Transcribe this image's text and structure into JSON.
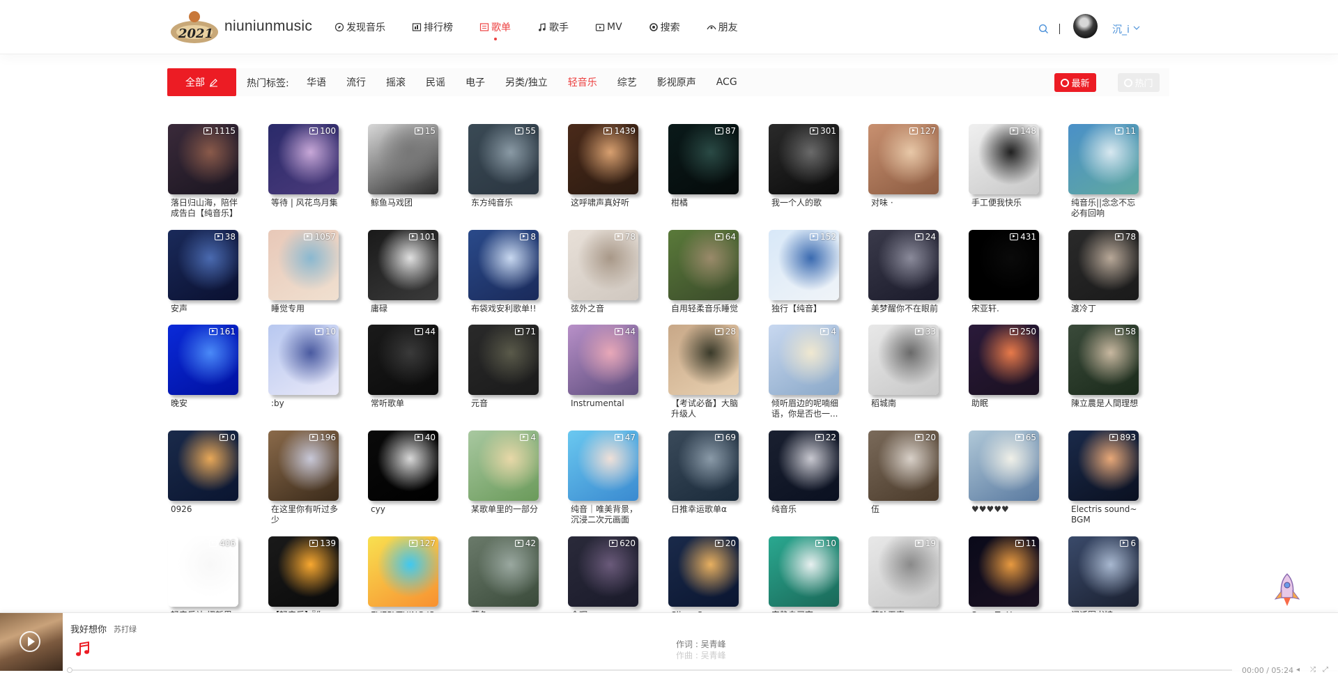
{
  "header": {
    "brand": "niuniunmusic",
    "logo_text": "2021",
    "nav": [
      {
        "label": "发现音乐",
        "icon": "discover-icon",
        "active": false
      },
      {
        "label": "排行榜",
        "icon": "ranking-icon",
        "active": false
      },
      {
        "label": "歌单",
        "icon": "playlist-icon",
        "active": true
      },
      {
        "label": "歌手",
        "icon": "singer-icon",
        "active": false
      },
      {
        "label": "MV",
        "icon": "mv-icon",
        "active": false
      },
      {
        "label": "搜索",
        "icon": "search-nav-icon",
        "active": false
      },
      {
        "label": "朋友",
        "icon": "friends-icon",
        "active": false
      }
    ],
    "user_name": "沉_i"
  },
  "filter": {
    "all_label": "全部",
    "hot_tags_label": "热门标签:",
    "tags": [
      "华语",
      "流行",
      "摇滚",
      "民谣",
      "电子",
      "另类/独立",
      "轻音乐",
      "综艺",
      "影视原声",
      "ACG"
    ],
    "active_tag": "轻音乐",
    "newest_label": "最新",
    "hottest_label": "热门"
  },
  "playlists": [
    {
      "title": "落日归山海，陪伴成告白【纯音乐】",
      "count": "1115",
      "colors": [
        "#3a2a3a",
        "#8a5a4a",
        "#1a1520"
      ]
    },
    {
      "title": "等待 | 风花鸟月集",
      "count": "100",
      "colors": [
        "#2a2a6a",
        "#c8a8d8",
        "#4a3a7a"
      ]
    },
    {
      "title": "鲸鱼马戏团",
      "count": "15",
      "colors": [
        "#d8d8d8",
        "#777777",
        "#2a2a2a"
      ]
    },
    {
      "title": "东方纯音乐",
      "count": "55",
      "colors": [
        "#3a4a55",
        "#8a9aa5",
        "#2a3540"
      ]
    },
    {
      "title": "这呼啸声真好听",
      "count": "1439",
      "colors": [
        "#4a2a1a",
        "#d8a070",
        "#2a1a10"
      ]
    },
    {
      "title": "柑橘",
      "count": "87",
      "colors": [
        "#0a1a1a",
        "#2a4a45",
        "#050a0a"
      ]
    },
    {
      "title": "我一个人的歌",
      "count": "301",
      "colors": [
        "#2a2a2a",
        "#6a6a6a",
        "#0a0a0a"
      ]
    },
    {
      "title": "对味 ·",
      "count": "127",
      "colors": [
        "#c89070",
        "#e8c8a8",
        "#8a5a40"
      ]
    },
    {
      "title": "手工便我快乐",
      "count": "148",
      "colors": [
        "#f0f0f0",
        "#202020",
        "#c8c8c8"
      ]
    },
    {
      "title": "纯音乐||念念不忘必有回响",
      "count": "11",
      "colors": [
        "#4a90c8",
        "#d8e8f0",
        "#60a8a0"
      ]
    },
    {
      "title": "安声",
      "count": "38",
      "colors": [
        "#1a2a5a",
        "#4a6ab0",
        "#0a1030"
      ]
    },
    {
      "title": "睡觉专用",
      "count": "1057",
      "colors": [
        "#e8c8b8",
        "#8ab8d0",
        "#f0e0d0"
      ]
    },
    {
      "title": "庸碌",
      "count": "101",
      "colors": [
        "#1a1a1a",
        "#e0e0e0",
        "#3a3a3a"
      ]
    },
    {
      "title": "布袋戏安利歌单!!",
      "count": "8",
      "colors": [
        "#2a4a8a",
        "#c8d8f0",
        "#1a2a5a"
      ]
    },
    {
      "title": "弦外之音",
      "count": "78",
      "colors": [
        "#e8e0d8",
        "#a89888",
        "#d0c8c0"
      ]
    },
    {
      "title": "自用轻柔音乐睡觉",
      "count": "64",
      "colors": [
        "#5a7a3a",
        "#9a8a6a",
        "#3a4a2a"
      ]
    },
    {
      "title": "独行【纯音】",
      "count": "152",
      "colors": [
        "#d8e8f8",
        "#3a6ab0",
        "#f0f4f8"
      ]
    },
    {
      "title": "美梦醒你不在眼前",
      "count": "24",
      "colors": [
        "#3a3a4a",
        "#8a8a9a",
        "#1a1a2a"
      ]
    },
    {
      "title": "宋亚轩.",
      "count": "431",
      "colors": [
        "#000000",
        "#0a0a0a",
        "#000000"
      ]
    },
    {
      "title": "渡冷丁",
      "count": "78",
      "colors": [
        "#2a2a2a",
        "#b8a898",
        "#1a1a1a"
      ]
    },
    {
      "title": "晚安",
      "count": "161",
      "colors": [
        "#0a2ad8",
        "#4a8af8",
        "#0010a0"
      ]
    },
    {
      "title": ":by",
      "count": "10",
      "colors": [
        "#b8c8f0",
        "#4a5aa0",
        "#e8e8f8"
      ]
    },
    {
      "title": "常听歌单",
      "count": "44",
      "colors": [
        "#1a1a1a",
        "#3a3a3a",
        "#0a0a0a"
      ]
    },
    {
      "title": "元音",
      "count": "71",
      "colors": [
        "#2a2a2a",
        "#5a5a4a",
        "#1a1a1a"
      ]
    },
    {
      "title": "Instrumental",
      "count": "44",
      "colors": [
        "#b890c8",
        "#e8a8b8",
        "#5a4a7a"
      ]
    },
    {
      "title": "【考试必备】大脑升级人",
      "count": "28",
      "colors": [
        "#c8a888",
        "#3a3a2a",
        "#e8d0b0"
      ]
    },
    {
      "title": "倾听眉边的呢喃细语，你是否也一...",
      "count": "4",
      "colors": [
        "#c8d8f0",
        "#f0e8d0",
        "#8aa8c8"
      ]
    },
    {
      "title": "稻城南",
      "count": "33",
      "colors": [
        "#e8e8e8",
        "#6a6a6a",
        "#c8c8c8"
      ]
    },
    {
      "title": "助眠",
      "count": "250",
      "colors": [
        "#2a1a3a",
        "#e87a4a",
        "#1a1020"
      ]
    },
    {
      "title": "陳立農是人間理想",
      "count": "58",
      "colors": [
        "#3a4a3a",
        "#c8b8a0",
        "#1a2a1a"
      ]
    },
    {
      "title": "0926",
      "count": "0",
      "colors": [
        "#1a2a4a",
        "#e8a858",
        "#0a1530"
      ]
    },
    {
      "title": "在这里你有听过多少",
      "count": "196",
      "colors": [
        "#8a6a4a",
        "#c8c8d8",
        "#3a2a1a"
      ]
    },
    {
      "title": "cyy",
      "count": "40",
      "colors": [
        "#0a0a0a",
        "#d8d8d8",
        "#000000"
      ]
    },
    {
      "title": "某歌单里的一部分",
      "count": "4",
      "colors": [
        "#a8c8a0",
        "#e8d8a8",
        "#6a9a5a"
      ]
    },
    {
      "title": "纯音｜唯美背景，沉浸二次元画面",
      "count": "47",
      "colors": [
        "#6ac8f0",
        "#f0e0d8",
        "#3a8ad0"
      ]
    },
    {
      "title": "日推幸运歌单α",
      "count": "69",
      "colors": [
        "#3a4a5a",
        "#8a9aa8",
        "#1a2a3a"
      ]
    },
    {
      "title": "纯音乐",
      "count": "22",
      "colors": [
        "#1a2030",
        "#c8c8d0",
        "#0a1020"
      ]
    },
    {
      "title": "伍",
      "count": "20",
      "colors": [
        "#7a6a5a",
        "#d8d0c8",
        "#4a3a2a"
      ]
    },
    {
      "title": "♥♥♥♥♥",
      "count": "65",
      "colors": [
        "#b0c8d8",
        "#f0f0e8",
        "#5a7aa0"
      ]
    },
    {
      "title": "Electris sound~BGM",
      "count": "893",
      "colors": [
        "#1a2a4a",
        "#e8a878",
        "#0a1020"
      ]
    },
    {
      "title": "轻音乐站 招新里",
      "count": "406",
      "colors": [
        "#ffffff",
        "#f8f8f8",
        "#ffffff"
      ]
    },
    {
      "title": "【轻音乐】·『你",
      "count": "139",
      "colors": [
        "#1a1a1a",
        "#f8a830",
        "#0a0a0a"
      ]
    },
    {
      "title": "EVERYTHING IS",
      "count": "127",
      "colors": [
        "#f8e050",
        "#40c8f0",
        "#f89030"
      ]
    },
    {
      "title": "暮色",
      "count": "42",
      "colors": [
        "#6a7a6a",
        "#9aa8a0",
        "#3a4a3a"
      ]
    },
    {
      "title": "余晖",
      "count": "620",
      "colors": [
        "#2a2a3a",
        "#6a5a7a",
        "#1a1a2a"
      ]
    },
    {
      "title": "Sliver Screen",
      "count": "20",
      "colors": [
        "#1a2a4a",
        "#e8b060",
        "#0a1530"
      ]
    },
    {
      "title": "安静自习室",
      "count": "10",
      "colors": [
        "#2aa890",
        "#e8f0f0",
        "#1a6858"
      ]
    },
    {
      "title": "落叶无声",
      "count": "19",
      "colors": [
        "#e8e8e8",
        "#8a8a8a",
        "#c8c8c8"
      ]
    },
    {
      "title": "Song To Your",
      "count": "11",
      "colors": [
        "#0a0a1a",
        "#e89a40",
        "#1a1020"
      ]
    },
    {
      "title": "闭话图书馆",
      "count": "6",
      "colors": [
        "#3a4a6a",
        "#a8b8d0",
        "#1a2030"
      ]
    }
  ],
  "player": {
    "song": "我好想你",
    "artist": "苏打绿",
    "lyric_line1": "作词 : 吴青峰",
    "lyric_line2": "作曲 : 吴青峰",
    "time": "00:00 / 05:24"
  }
}
